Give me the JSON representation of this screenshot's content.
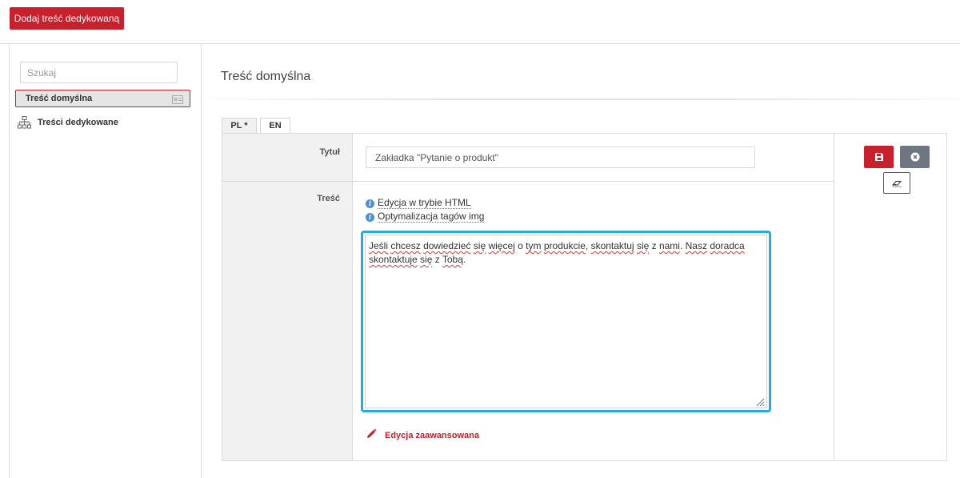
{
  "toolbar": {
    "add_button_label": "Dodaj treść dedykowaną"
  },
  "sidebar": {
    "search_placeholder": "Szukaj",
    "items": [
      {
        "label": "Treść domyślna",
        "active": true,
        "icon": "card-icon"
      },
      {
        "label": "Treści dedykowane",
        "active": false,
        "icon": "sitemap-icon"
      }
    ]
  },
  "main": {
    "title": "Treść domyślna",
    "tabs": [
      {
        "label": "PL *",
        "active": true
      },
      {
        "label": "EN",
        "active": false
      }
    ],
    "form": {
      "title_label": "Tytuł",
      "title_value": "Zakładka \"Pytanie o produkt\"",
      "content_label": "Treść",
      "options": [
        {
          "label": "Edycja w trybie HTML",
          "icon": "info-icon"
        },
        {
          "label": "Optymalizacja tagów img",
          "icon": "info-icon"
        }
      ],
      "editor_segments": [
        {
          "text": "Jeśli",
          "misspelled": true
        },
        {
          "text": " "
        },
        {
          "text": "chcesz",
          "misspelled": true
        },
        {
          "text": " "
        },
        {
          "text": "dowiedzieć",
          "misspelled": true
        },
        {
          "text": " "
        },
        {
          "text": "się",
          "misspelled": true
        },
        {
          "text": " "
        },
        {
          "text": "więcej",
          "misspelled": true
        },
        {
          "text": " o "
        },
        {
          "text": "tym",
          "misspelled": true
        },
        {
          "text": " "
        },
        {
          "text": "produkcie",
          "misspelled": true
        },
        {
          "text": ", "
        },
        {
          "text": "skontaktuj",
          "misspelled": true
        },
        {
          "text": " "
        },
        {
          "text": "się",
          "misspelled": true
        },
        {
          "text": " z "
        },
        {
          "text": "nami",
          "misspelled": true
        },
        {
          "text": ". "
        },
        {
          "text": "Nasz",
          "misspelled": true
        },
        {
          "text": " "
        },
        {
          "text": "doradca",
          "misspelled": true
        },
        {
          "text": " "
        },
        {
          "text": "skontaktuje",
          "misspelled": true
        },
        {
          "text": " "
        },
        {
          "text": "się",
          "misspelled": true
        },
        {
          "text": " z "
        },
        {
          "text": "Tobą",
          "misspelled": true
        },
        {
          "text": "."
        }
      ],
      "advanced_label": "Edycja zaawansowana"
    },
    "actions": {
      "save_icon": "floppy-icon",
      "close_icon": "close-circle-icon",
      "erase_icon": "eraser-icon"
    }
  },
  "colors": {
    "accent": "#c8202d",
    "focus": "#27a9e1",
    "secondary_button": "#6e7681",
    "panel_bg": "#f1f1f1"
  }
}
